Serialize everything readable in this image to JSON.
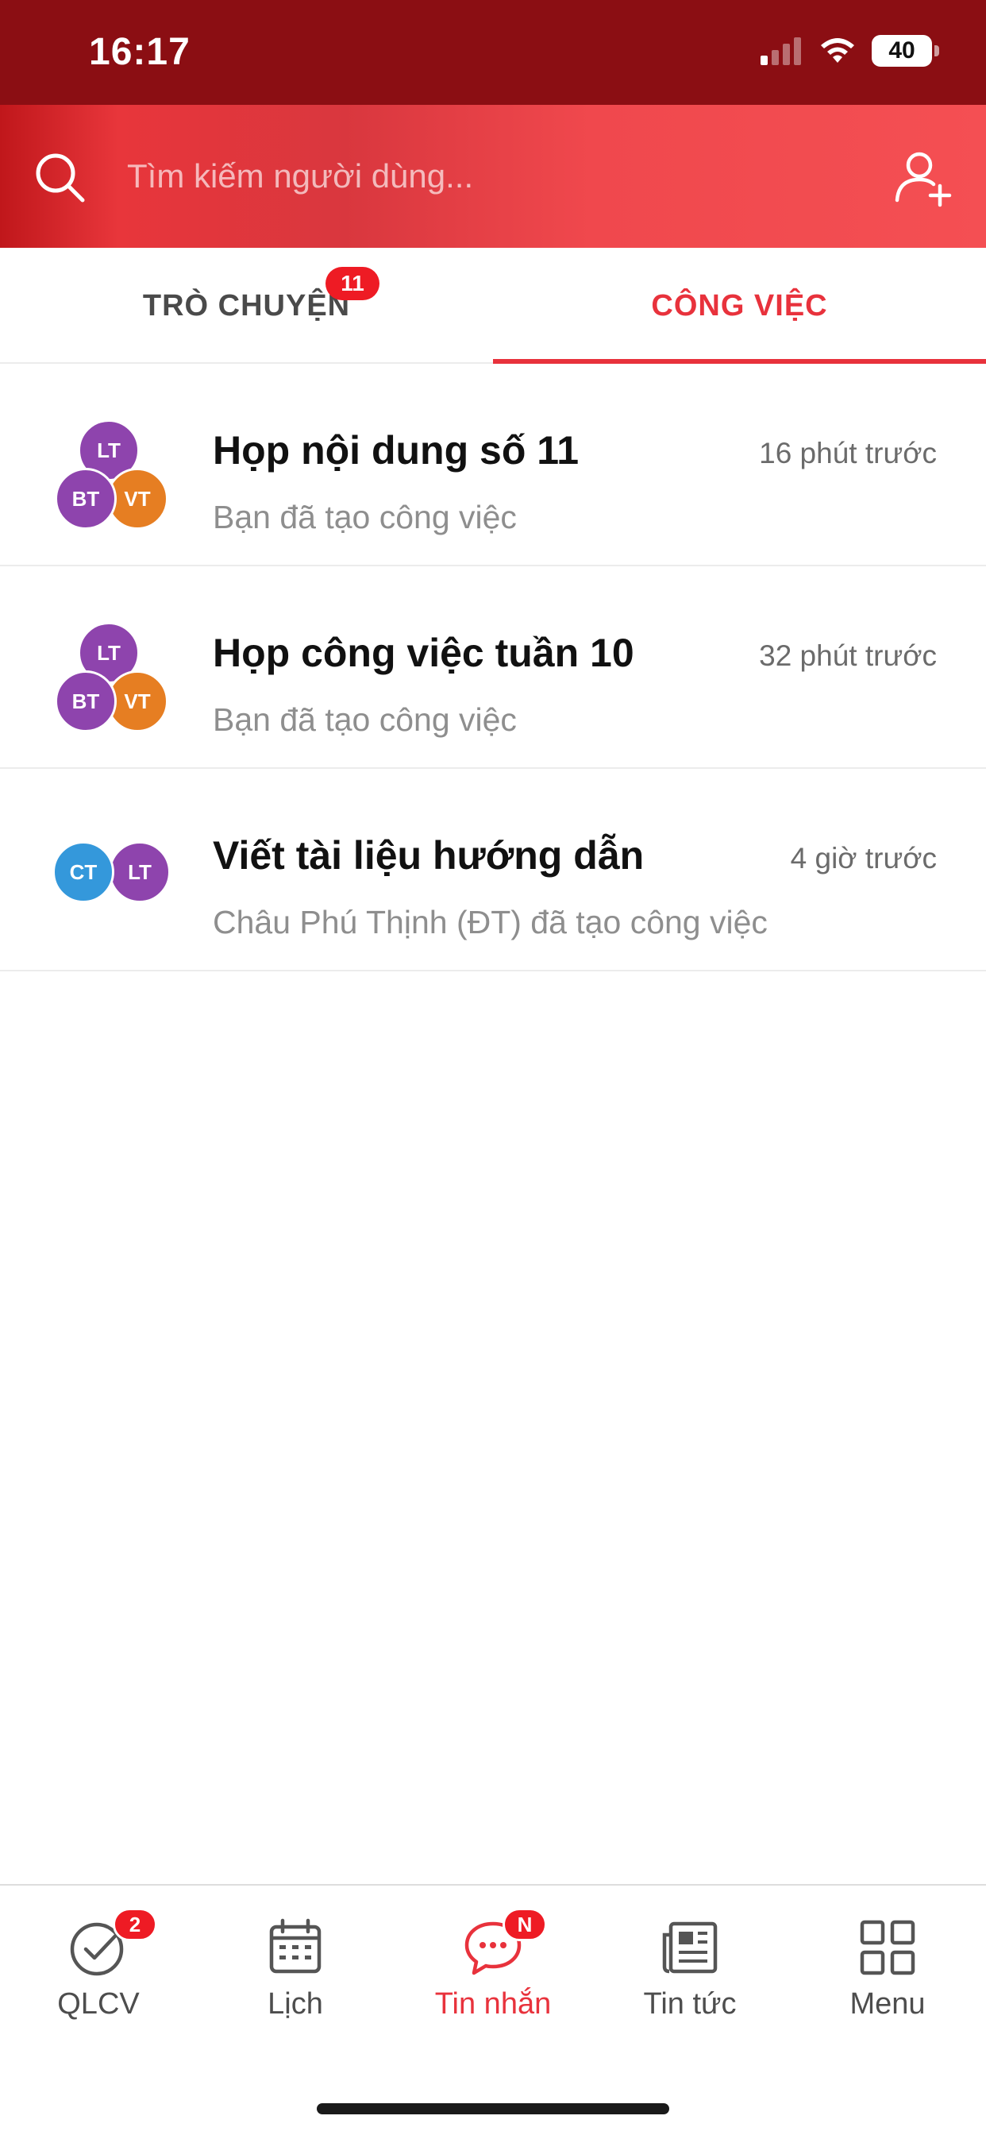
{
  "status_bar": {
    "time": "16:17",
    "battery": "40"
  },
  "search": {
    "placeholder": "Tìm kiếm người dùng..."
  },
  "tabs": [
    {
      "label": "TRÒ CHUYỆN",
      "badge": "11",
      "active": false
    },
    {
      "label": "CÔNG VIỆC",
      "active": true
    }
  ],
  "tasks": [
    {
      "title": "Họp nội dung số 11",
      "time": "16 phút trước",
      "subtitle": "Bạn đã tạo công việc",
      "avatars": [
        {
          "initials": "LT",
          "color": "#8e44ad"
        },
        {
          "initials": "BT",
          "color": "#8e44ad"
        },
        {
          "initials": "VT",
          "color": "#e67e22"
        }
      ]
    },
    {
      "title": "Họp công việc tuần 10",
      "time": "32 phút trước",
      "subtitle": "Bạn đã tạo công việc",
      "avatars": [
        {
          "initials": "LT",
          "color": "#8e44ad"
        },
        {
          "initials": "BT",
          "color": "#8e44ad"
        },
        {
          "initials": "VT",
          "color": "#e67e22"
        }
      ]
    },
    {
      "title": "Viết tài liệu hướng dẫn",
      "time": "4 giờ trước",
      "subtitle": "Châu Phú Thịnh (ĐT) đã tạo công việc",
      "avatars": [
        {
          "initials": "CT",
          "color": "#3498db"
        },
        {
          "initials": "LT",
          "color": "#8e44ad"
        }
      ]
    }
  ],
  "bottom_nav": [
    {
      "label": "QLCV",
      "icon": "check-circle-icon",
      "badge": "2"
    },
    {
      "label": "Lịch",
      "icon": "calendar-icon"
    },
    {
      "label": "Tin nhắn",
      "icon": "chat-bubble-icon",
      "badge": "N",
      "active": true
    },
    {
      "label": "Tin tức",
      "icon": "newspaper-icon"
    },
    {
      "label": "Menu",
      "icon": "grid-icon"
    }
  ],
  "colors": {
    "accent": "#e8323c",
    "status_bar": "#8b0e13",
    "badge": "#ee1b24"
  }
}
